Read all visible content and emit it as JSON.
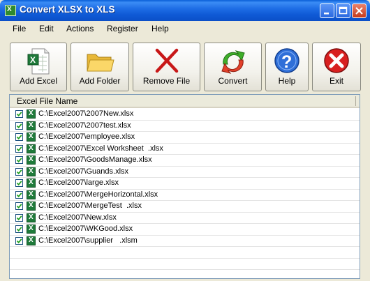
{
  "window": {
    "title": "Convert XLSX to XLS"
  },
  "menu": [
    "File",
    "Edit",
    "Actions",
    "Register",
    "Help"
  ],
  "toolbar": {
    "add_excel": "Add Excel",
    "add_folder": "Add Folder",
    "remove_file": "Remove File",
    "convert": "Convert",
    "help": "Help",
    "exit": "Exit"
  },
  "list": {
    "header": "Excel File Name",
    "files": [
      "C:\\Excel2007\\2007New.xlsx",
      "C:\\Excel2007\\2007test.xlsx",
      "C:\\Excel2007\\employee.xlsx",
      "C:\\Excel2007\\Excel Worksheet  .xlsx",
      "C:\\Excel2007\\GoodsManage.xlsx",
      "C:\\Excel2007\\Guands.xlsx",
      "C:\\Excel2007\\large.xlsx",
      "C:\\Excel2007\\MergeHorizontal.xlsx",
      "C:\\Excel2007\\MergeTest  .xlsx",
      "C:\\Excel2007\\New.xlsx",
      "C:\\Excel2007\\WKGood.xlsx",
      "C:\\Excel2007\\supplier   .xlsm"
    ]
  },
  "colors": {
    "titlebar": "#0f5ad6",
    "window_bg": "#ece9d8",
    "list_border": "#7f9db9"
  },
  "icons": [
    "excel-file-icon",
    "folder-icon",
    "remove-x-icon",
    "convert-arrows-icon",
    "help-question-icon",
    "exit-x-icon"
  ]
}
